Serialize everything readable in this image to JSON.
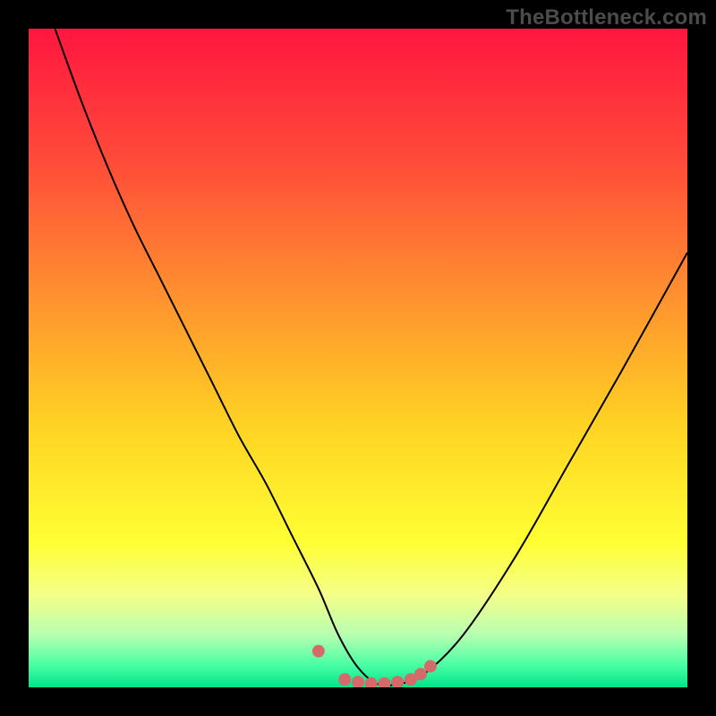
{
  "watermark": {
    "text": "TheBottleneck.com"
  },
  "chart_data": {
    "type": "line",
    "title": "",
    "xlabel": "",
    "ylabel": "",
    "xlim": [
      0,
      100
    ],
    "ylim": [
      0,
      100
    ],
    "grid": false,
    "legend": null,
    "gradient_stops": [
      {
        "offset": 0.0,
        "color": "#ff163f"
      },
      {
        "offset": 0.2,
        "color": "#ff4b39"
      },
      {
        "offset": 0.4,
        "color": "#ff8f2f"
      },
      {
        "offset": 0.6,
        "color": "#ffd223"
      },
      {
        "offset": 0.78,
        "color": "#ffff33"
      },
      {
        "offset": 0.86,
        "color": "#f4ff8a"
      },
      {
        "offset": 0.92,
        "color": "#b7ffb1"
      },
      {
        "offset": 0.965,
        "color": "#4dffa4"
      },
      {
        "offset": 1.0,
        "color": "#00e58b"
      }
    ],
    "series": [
      {
        "name": "bottleneck-curve",
        "color": "#000000",
        "stroke_width": 2,
        "x": [
          4,
          8,
          12,
          16,
          20,
          24,
          28,
          32,
          36,
          40,
          44,
          47,
          50,
          53,
          56,
          60,
          66,
          74,
          82,
          90,
          100
        ],
        "y": [
          100,
          89,
          79,
          70,
          62,
          54,
          46,
          38,
          31,
          23,
          15,
          8,
          3,
          0.5,
          0.5,
          2,
          8,
          20,
          34,
          48,
          66
        ]
      }
    ],
    "markers": {
      "name": "optimal-zone-dots",
      "color": "#d46a6a",
      "radius": 7,
      "points": [
        {
          "x": 44.0,
          "y": 5.5
        },
        {
          "x": 48.0,
          "y": 1.2
        },
        {
          "x": 50.0,
          "y": 0.8
        },
        {
          "x": 52.0,
          "y": 0.6
        },
        {
          "x": 54.0,
          "y": 0.6
        },
        {
          "x": 56.0,
          "y": 0.8
        },
        {
          "x": 58.0,
          "y": 1.2
        },
        {
          "x": 59.5,
          "y": 2.0
        },
        {
          "x": 61.0,
          "y": 3.2
        }
      ]
    }
  }
}
